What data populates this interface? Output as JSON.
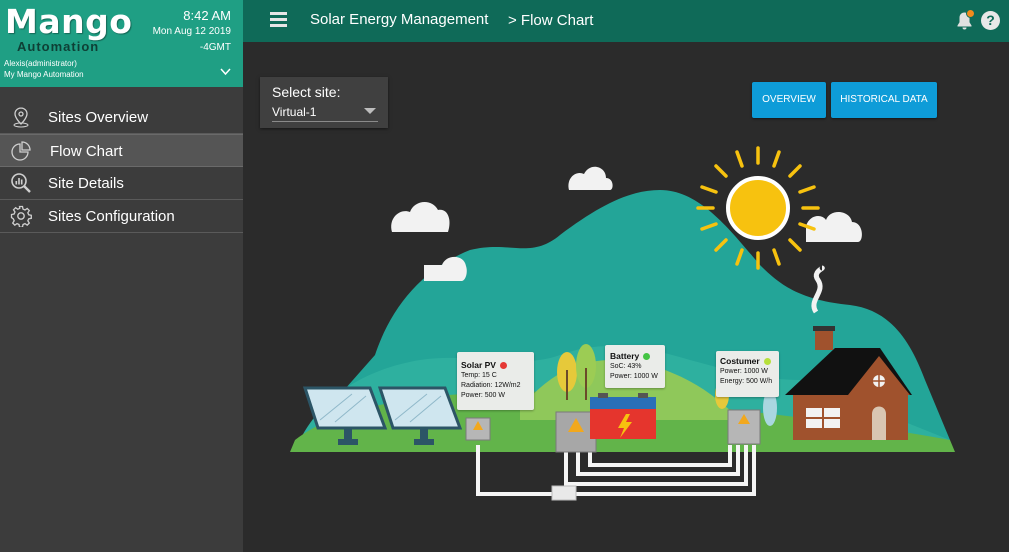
{
  "brand": {
    "logo": "Mango",
    "logo_sub": "Automation",
    "time": "8:42 AM",
    "date": "Mon Aug 12 2019",
    "timezone": "-4GMT",
    "user": "Alexis(administrator)",
    "app_name": "My Mango Automation"
  },
  "sidebar": {
    "items": [
      {
        "label": "Sites Overview",
        "icon": "map-pin-icon",
        "active": false
      },
      {
        "label": "Flow Chart",
        "icon": "pie-chart-icon",
        "active": true
      },
      {
        "label": "Site Details",
        "icon": "search-chart-icon",
        "active": false
      },
      {
        "label": "Sites Configuration",
        "icon": "gear-icon",
        "active": false
      }
    ]
  },
  "header": {
    "title": "Solar Energy Management",
    "breadcrumb": "> Flow Chart"
  },
  "site_select": {
    "label": "Select site:",
    "value": "Virtual-1"
  },
  "buttons": {
    "overview": "OVERVIEW",
    "historical": "HISTORICAL DATA"
  },
  "cards": {
    "solar_pv": {
      "title": "Solar PV",
      "status_color": "#e53935",
      "temp": "Temp: 15 C",
      "radiation": "Radiation: 12W/m2",
      "power": "Power: 500 W"
    },
    "battery": {
      "title": "Battery",
      "status_color": "#43c443",
      "soc": "SoC: 43%",
      "power": "Power: 1000 W"
    },
    "costumer": {
      "title": "Costumer",
      "status_color": "#b6e03b",
      "power": "Power: 1000 W",
      "energy": "Energy: 500 W/h"
    }
  },
  "colors": {
    "brand_green": "#1f9f84",
    "header_green": "#0f6a58",
    "sidebar_bg": "#3c3c3c",
    "button_blue": "#0e9cd8"
  }
}
